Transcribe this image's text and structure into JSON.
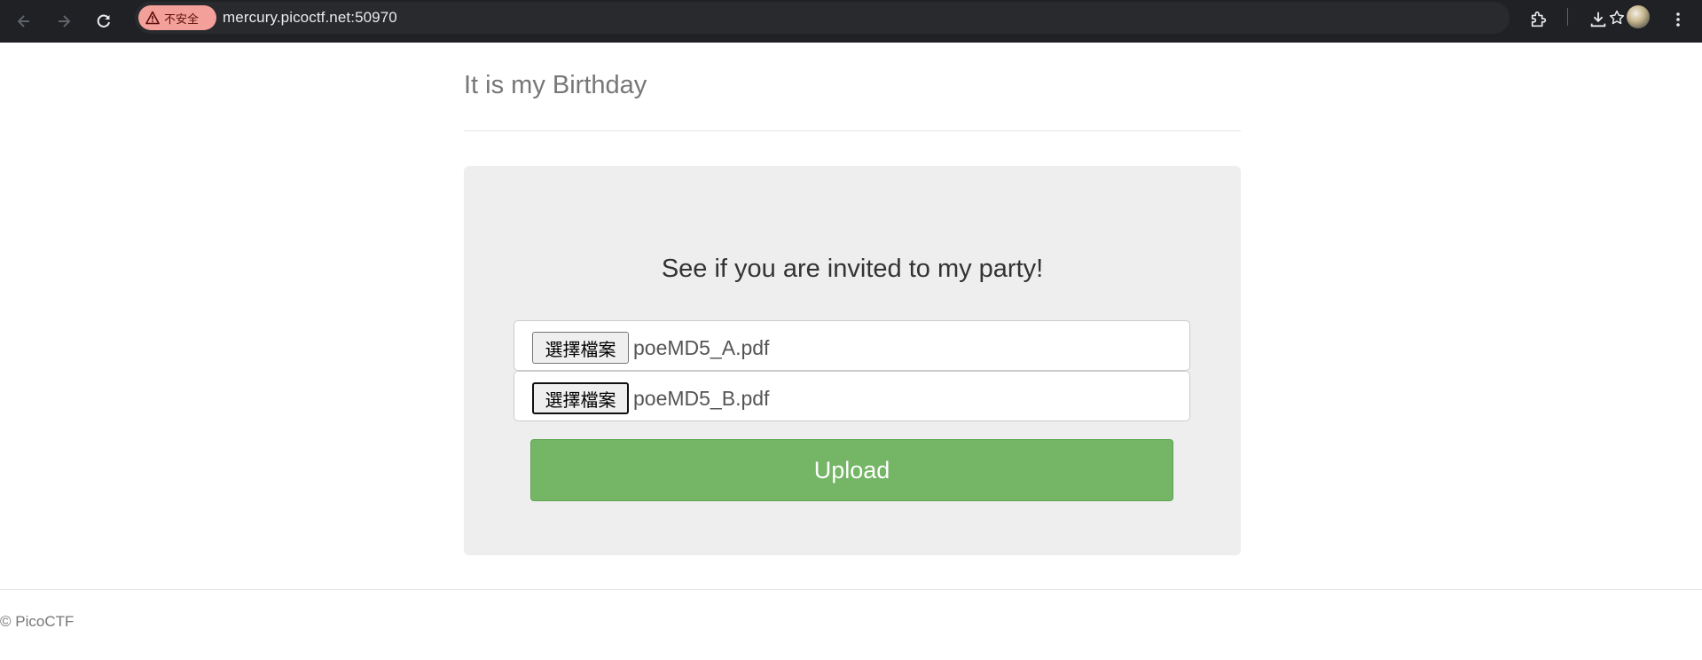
{
  "browser": {
    "security_chip": "不安全",
    "url": "mercury.picoctf.net:50970",
    "icons": [
      "back-arrow-icon",
      "forward-arrow-icon",
      "reload-icon",
      "warning-icon",
      "star-icon",
      "extensions-icon",
      "download-icon",
      "avatar",
      "menu-icon"
    ]
  },
  "page": {
    "title": "It is my Birthday",
    "heading": "See if you are invited to my party!",
    "files": [
      {
        "button_label": "選擇檔案",
        "file_name": "poeMD5_A.pdf"
      },
      {
        "button_label": "選擇檔案",
        "file_name": "poeMD5_B.pdf"
      }
    ],
    "upload_label": "Upload",
    "footer": "© PicoCTF"
  },
  "colors": {
    "toolbar": "#202124",
    "panel": "#eeeeee",
    "upload_button": "#74b566",
    "chip": "#f4a09a"
  }
}
